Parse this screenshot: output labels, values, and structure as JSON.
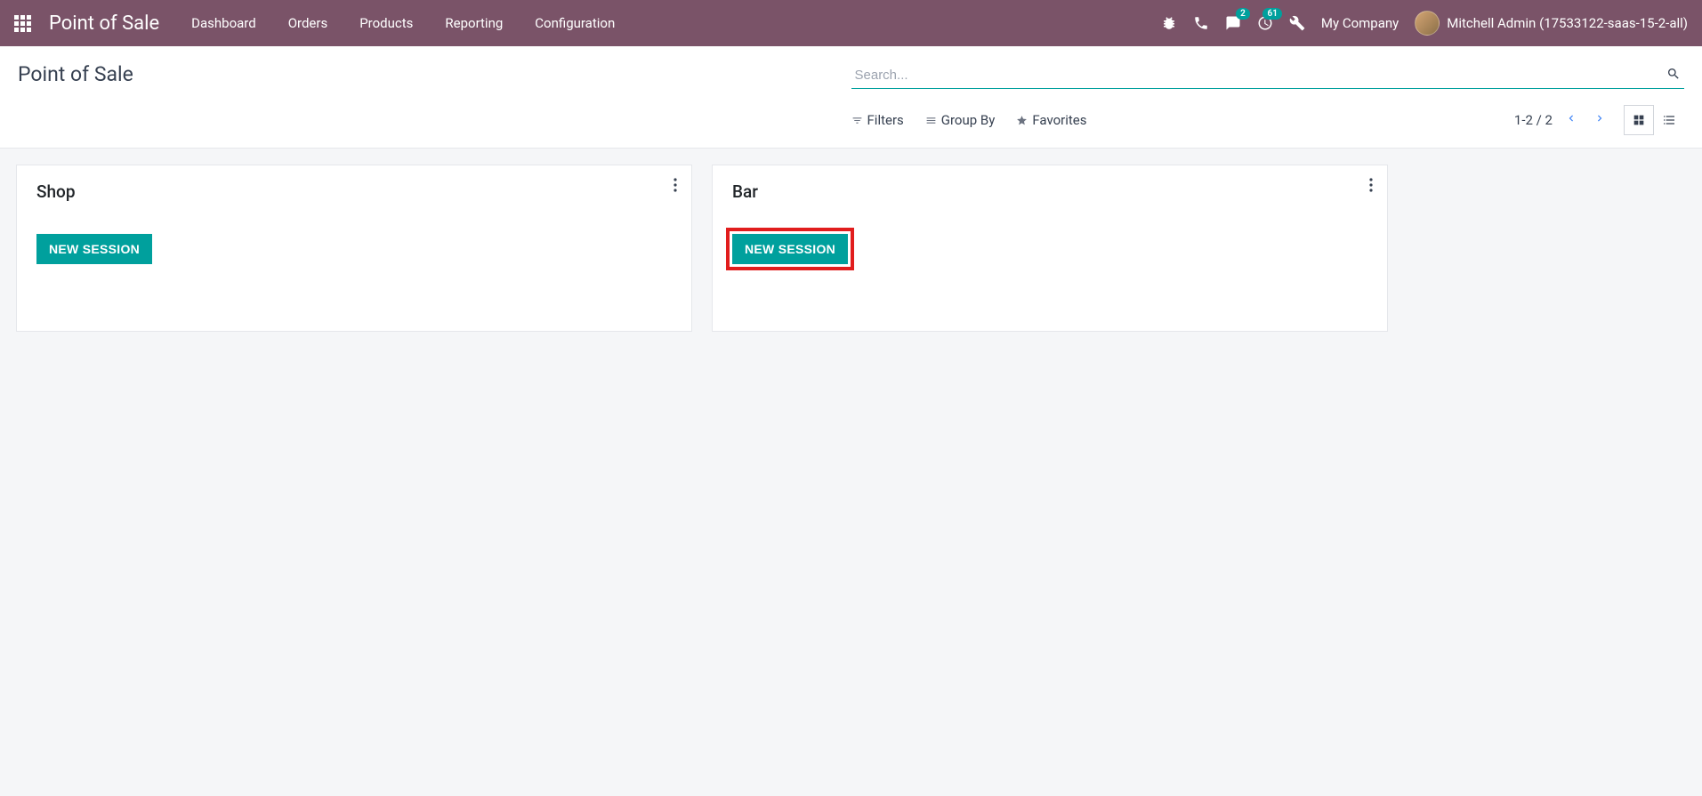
{
  "header": {
    "app_title": "Point of Sale",
    "nav_items": [
      "Dashboard",
      "Orders",
      "Products",
      "Reporting",
      "Configuration"
    ],
    "messages_badge": "2",
    "activity_badge": "61",
    "company": "My Company",
    "user": "Mitchell Admin (17533122-saas-15-2-all)"
  },
  "control": {
    "breadcrumb": "Point of Sale",
    "search_placeholder": "Search...",
    "filters_label": "Filters",
    "groupby_label": "Group By",
    "favorites_label": "Favorites",
    "pager_text": "1-2 / 2"
  },
  "cards": [
    {
      "title": "Shop",
      "button": "NEW SESSION",
      "highlighted": false
    },
    {
      "title": "Bar",
      "button": "NEW SESSION",
      "highlighted": true
    }
  ]
}
